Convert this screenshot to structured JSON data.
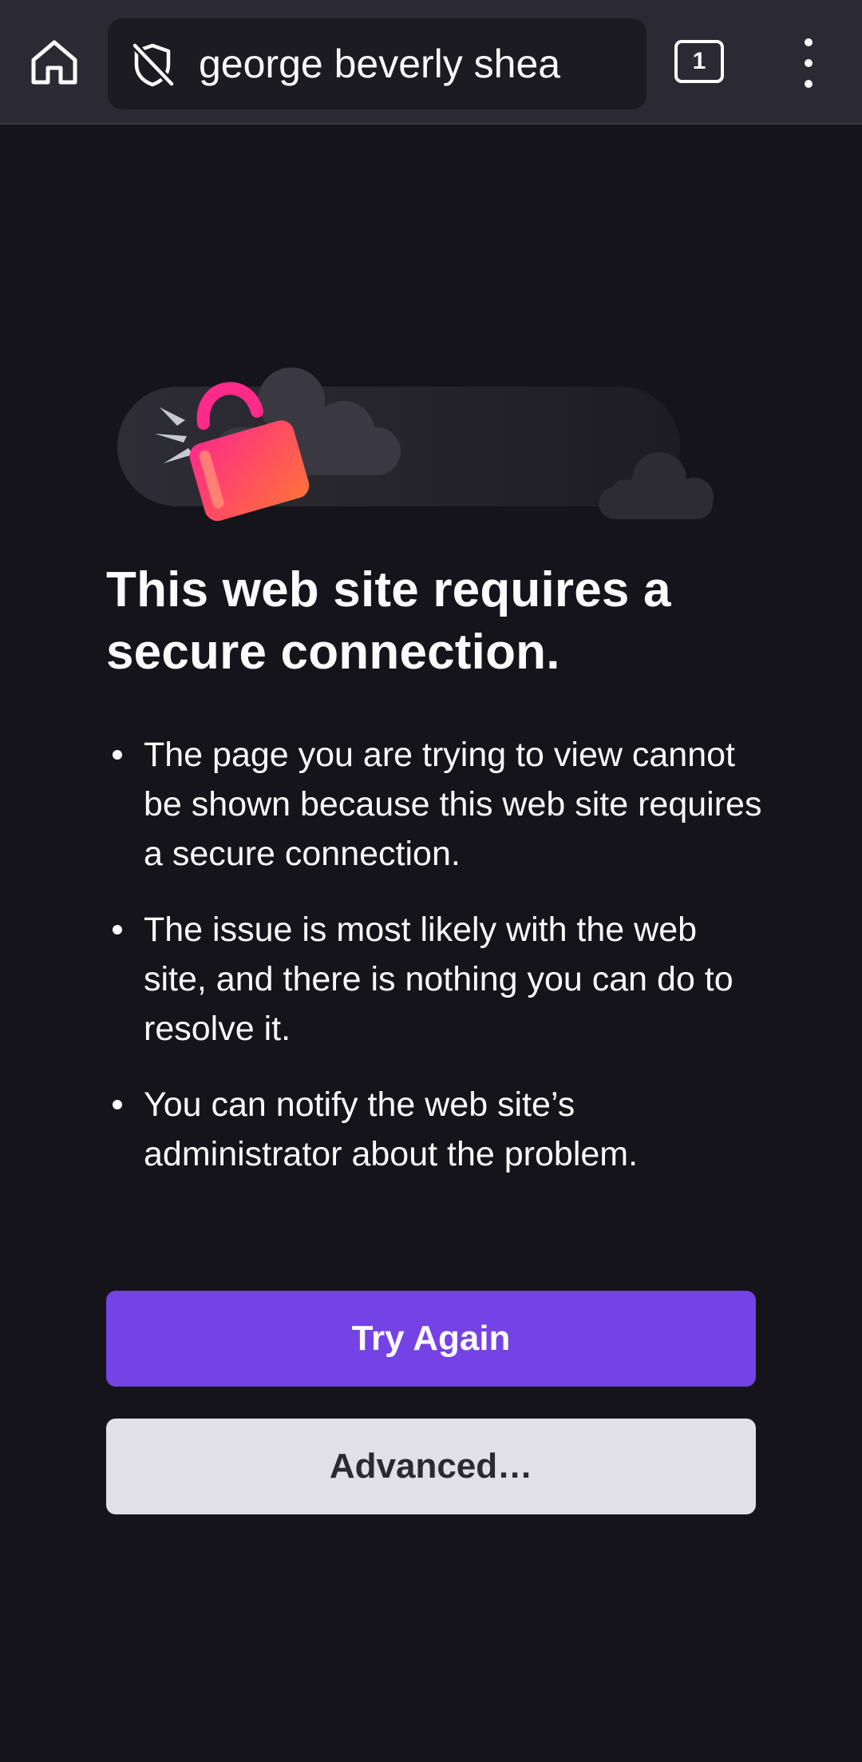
{
  "toolbar": {
    "url": "george beverly shea",
    "tab_count": "1",
    "home_icon": "home-icon",
    "security_icon": "shield-slash-icon",
    "menu_icon": "kebab-menu-icon"
  },
  "error_page": {
    "title": "This web site requires a secure connection.",
    "reasons": [
      "The page you are trying to view cannot be shown because this web site requires a secure connection.",
      "The issue is most likely with the web site, and there is nothing you can do to resolve it.",
      "You can notify the web site’s administrator about the problem."
    ],
    "try_again_label": "Try Again",
    "advanced_label": "Advanced…"
  },
  "colors": {
    "background": "#15141a",
    "toolbar": "#2b2a33",
    "urlbar": "#1c1b22",
    "primary_button": "#7542e5",
    "secondary_button": "#e0e0e6",
    "lock_gradient_start": "#ff2a8a",
    "lock_gradient_end": "#ff7139"
  }
}
